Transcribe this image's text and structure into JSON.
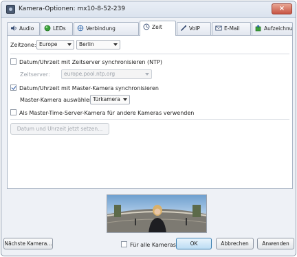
{
  "window": {
    "title": "Kamera-Optionen: mx10-8-52-239",
    "close_label": "×"
  },
  "tabs": [
    {
      "label": "Audio",
      "icon": "speaker-icon",
      "active": false
    },
    {
      "label": "LEDs",
      "icon": "led-icon",
      "active": false
    },
    {
      "label": "Verbindung",
      "icon": "connection-icon",
      "active": false
    },
    {
      "label": "Zeit",
      "icon": "clock-icon",
      "active": true
    },
    {
      "label": "VoIP",
      "icon": "phone-icon",
      "active": false
    },
    {
      "label": "E-Mail",
      "icon": "mail-icon",
      "active": false
    },
    {
      "label": "Aufzeichnung",
      "icon": "recording-icon",
      "active": false
    }
  ],
  "zeit": {
    "timezone_label": "Zeitzone:",
    "region_value": "Europe",
    "city_value": "Berlin",
    "ntp_checkbox_label": "Datum/Uhrzeit mit Zeitserver synchronisieren (NTP)",
    "ntp_checked": false,
    "server_label": "Zeitserver:",
    "server_value": "europe.pool.ntp.org",
    "master_checkbox_label": "Datum/Uhrzeit mit Master-Kamera synchronisieren",
    "master_checked": true,
    "master_select_label": "Master-Kamera auswählen:",
    "master_select_value": "Türkamera",
    "time_server_checkbox_label": "Als Master-Time-Server-Kamera für andere Kameras verwenden",
    "time_server_checked": false,
    "set_now_button": "Datum und Uhrzeit jetzt setzen..."
  },
  "footer": {
    "next_camera_button": "Nächste Kamera...",
    "all_cameras_label": "Für alle Kameras",
    "all_cameras_checked": false,
    "ok_button": "OK",
    "cancel_button": "Abbrechen",
    "apply_button": "Anwenden"
  },
  "colors": {
    "accent": "#3c7fb1",
    "close_button": "#c75443",
    "window_bg": "#eef1f6"
  }
}
